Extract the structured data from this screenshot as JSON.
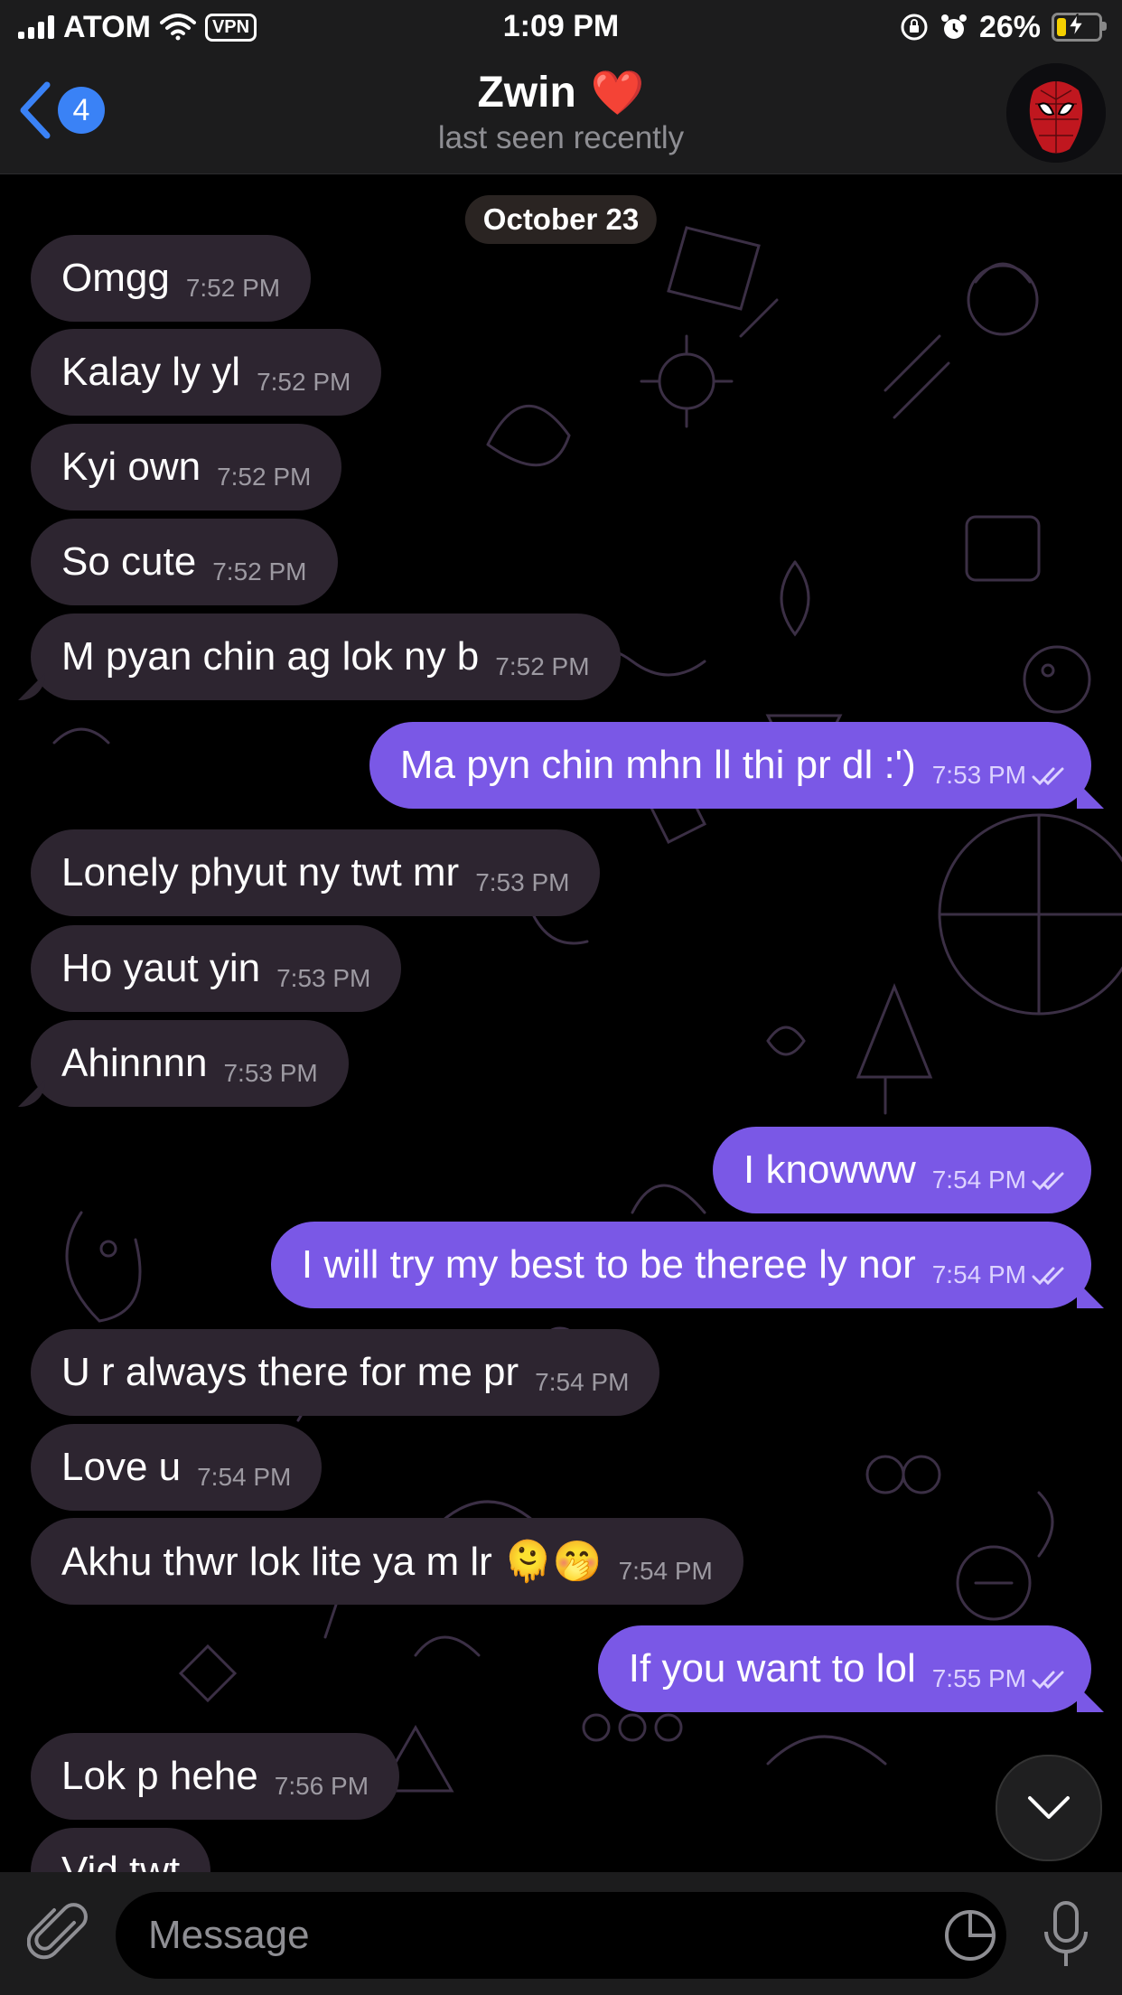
{
  "status_bar": {
    "carrier": "ATOM",
    "vpn": "VPN",
    "time": "1:09 PM",
    "battery_percent": "26%",
    "battery_level": 0.26,
    "icons": [
      "signal-icon",
      "wifi-icon",
      "vpn-badge",
      "rotation-lock-icon",
      "alarm-icon",
      "battery-charging-icon"
    ]
  },
  "header": {
    "back_count": "4",
    "name": "Zwin",
    "name_emoji": "❤️",
    "status": "last seen recently"
  },
  "date_separator": "October 23",
  "messages": [
    {
      "dir": "in",
      "text": "Omgg",
      "time": "7:52 PM"
    },
    {
      "dir": "in",
      "text": "Kalay ly yl",
      "time": "7:52 PM"
    },
    {
      "dir": "in",
      "text": "Kyi own",
      "time": "7:52 PM"
    },
    {
      "dir": "in",
      "text": "So cute",
      "time": "7:52 PM"
    },
    {
      "dir": "in",
      "text": "M pyan chin ag lok ny b",
      "time": "7:52 PM"
    },
    {
      "dir": "out",
      "text": "Ma pyn chin mhn ll thi pr dl :')",
      "time": "7:53 PM"
    },
    {
      "dir": "in",
      "text": "Lonely phyut ny twt mr",
      "time": "7:53 PM"
    },
    {
      "dir": "in",
      "text": "Ho yaut yin",
      "time": "7:53 PM"
    },
    {
      "dir": "in",
      "text": "Ahinnnn",
      "time": "7:53 PM"
    },
    {
      "dir": "out",
      "text": "I knowww",
      "time": "7:54 PM"
    },
    {
      "dir": "out",
      "text": "I will try my best to be theree ly nor",
      "time": "7:54 PM"
    },
    {
      "dir": "in",
      "text": "U r always there for me pr",
      "time": "7:54 PM"
    },
    {
      "dir": "in",
      "text": "Love u",
      "time": "7:54 PM"
    },
    {
      "dir": "in",
      "text": "Akhu thwr lok lite ya m lr 🫠🤭",
      "time": "7:54 PM"
    },
    {
      "dir": "out",
      "text": "If you want to lol",
      "time": "7:55 PM"
    },
    {
      "dir": "in",
      "text": "Lok p hehe",
      "time": "7:56 PM"
    },
    {
      "dir": "in",
      "text": "Vid twt",
      "time": ""
    }
  ],
  "input": {
    "placeholder": "Message"
  },
  "colors": {
    "incoming_bubble": "#2d2530",
    "outgoing_bubble": "#7a58e6",
    "bar_background": "#1c1c1d",
    "accent_blue": "#3a82f6"
  }
}
